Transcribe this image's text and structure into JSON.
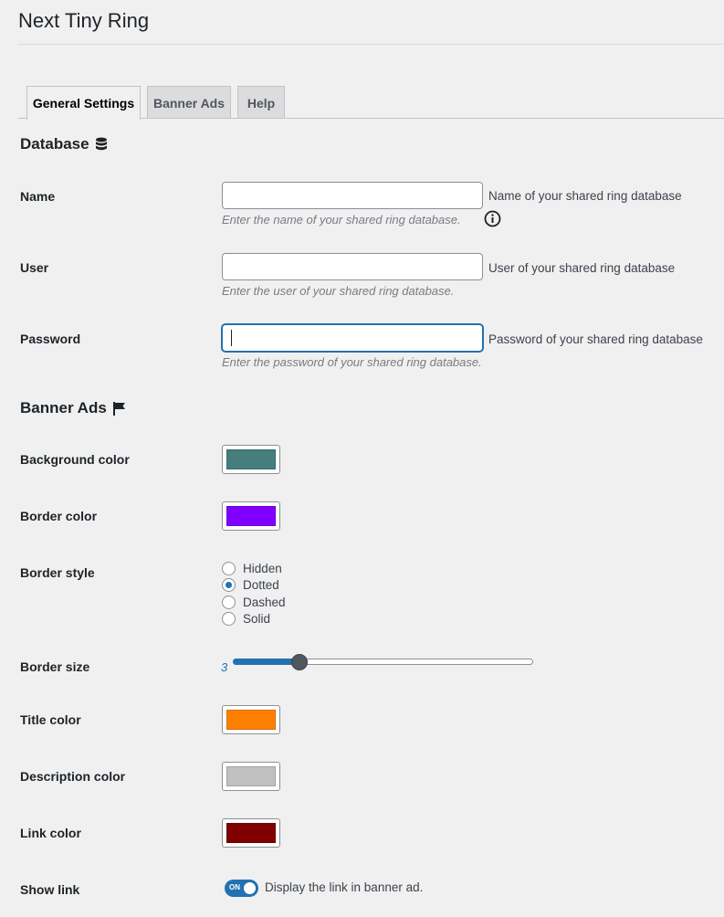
{
  "page": {
    "title": "Next Tiny Ring"
  },
  "tabs": [
    {
      "label": "General Settings",
      "active": true
    },
    {
      "label": "Banner Ads",
      "active": false
    },
    {
      "label": "Help",
      "active": false
    }
  ],
  "database": {
    "heading": "Database",
    "icon": "database-icon",
    "name": {
      "label": "Name",
      "value": "",
      "hint": "Name of your shared ring database",
      "description": "Enter the name of your shared ring database."
    },
    "user": {
      "label": "User",
      "value": "",
      "hint": "User of your shared ring database",
      "description": "Enter the user of your shared ring database."
    },
    "password": {
      "label": "Password",
      "value": "",
      "hint": "Password of your shared ring database",
      "description": "Enter the password of your shared ring database."
    }
  },
  "banner_ads": {
    "heading": "Banner Ads",
    "icon": "flag-icon",
    "background_color": {
      "label": "Background color",
      "color": "#467d7d"
    },
    "border_color": {
      "label": "Border color",
      "color": "#8000ff"
    },
    "border_style": {
      "label": "Border style",
      "options": [
        "Hidden",
        "Dotted",
        "Dashed",
        "Solid"
      ],
      "selected": "Dotted"
    },
    "border_size": {
      "label": "Border size",
      "value": "3",
      "min": 0,
      "max": 10,
      "current": 3
    },
    "title_color": {
      "label": "Title color",
      "color": "#ff8000"
    },
    "description_color": {
      "label": "Description color",
      "color": "#c0c0c0"
    },
    "link_color": {
      "label": "Link color",
      "color": "#800000"
    },
    "show_link": {
      "label": "Show link",
      "toggle_text": "ON",
      "enabled": true,
      "description": "Display the link in banner ad."
    }
  },
  "colors": {
    "accent": "#2271b1",
    "background": "#f0f0f1"
  }
}
